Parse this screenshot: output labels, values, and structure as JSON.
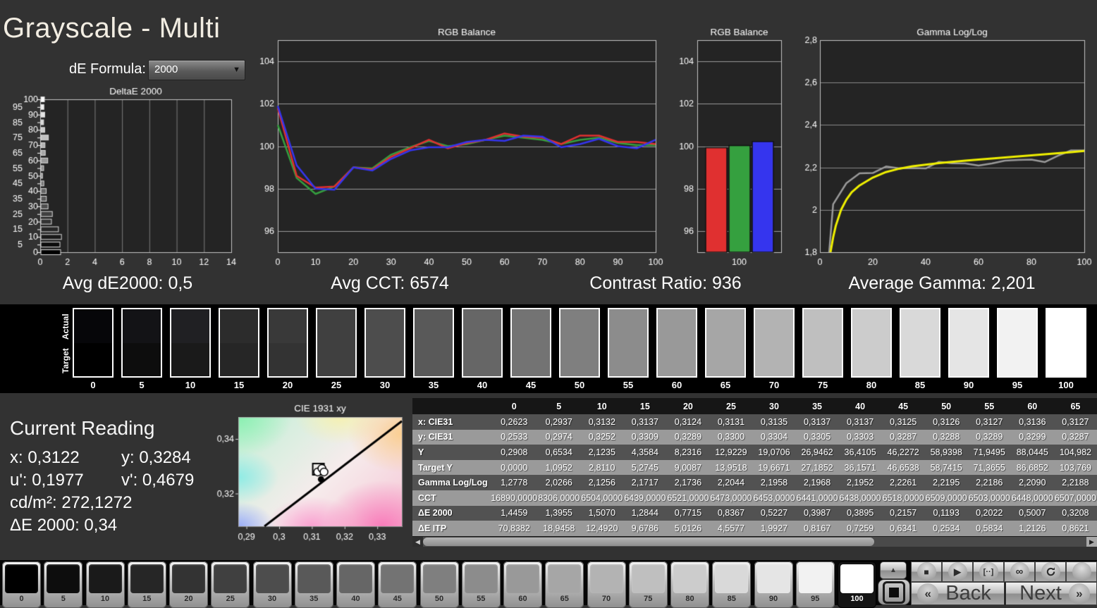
{
  "window": {
    "title": "Grayscale - Multi"
  },
  "controls": {
    "de_formula_label": "dE Formula:",
    "de_formula_value": "2000",
    "dropdown_arrow": "▼"
  },
  "stats": {
    "avg_de2000": "Avg dE2000: 0,5",
    "avg_cct": "Avg CCT: 6574",
    "contrast_ratio": "Contrast Ratio: 936",
    "average_gamma": "Average Gamma: 2,201"
  },
  "current_reading": {
    "heading": "Current Reading",
    "x": "x: 0,3122",
    "y": "y: 0,3284",
    "u": "u': 0,1977",
    "v": "v': 0,4679",
    "cd": "cd/m²: 272,1272",
    "de": "ΔE 2000: 0,34"
  },
  "swatch_strip": {
    "actual_label": "Actual",
    "target_label": "Target",
    "levels": [
      0,
      5,
      10,
      15,
      20,
      25,
      30,
      35,
      40,
      45,
      50,
      55,
      60,
      65,
      70,
      75,
      80,
      85,
      90,
      95,
      100
    ]
  },
  "table": {
    "columns": [
      "0",
      "5",
      "10",
      "15",
      "20",
      "25",
      "30",
      "35",
      "40",
      "45",
      "50",
      "55",
      "60",
      "65"
    ],
    "rows": [
      {
        "label": "x: CIE31",
        "values": [
          "0,2623",
          "0,2937",
          "0,3132",
          "0,3137",
          "0,3124",
          "0,3131",
          "0,3135",
          "0,3137",
          "0,3137",
          "0,3125",
          "0,3126",
          "0,3127",
          "0,3136",
          "0,3127"
        ]
      },
      {
        "label": "y: CIE31",
        "values": [
          "0,2533",
          "0,2974",
          "0,3252",
          "0,3309",
          "0,3289",
          "0,3300",
          "0,3304",
          "0,3305",
          "0,3303",
          "0,3287",
          "0,3288",
          "0,3289",
          "0,3299",
          "0,3287"
        ]
      },
      {
        "label": "Y",
        "values": [
          "0,2908",
          "0,6534",
          "2,1235",
          "4,3584",
          "8,2316",
          "12,9229",
          "19,0706",
          "26,9462",
          "36,4105",
          "46,2272",
          "58,9398",
          "71,9495",
          "88,0445",
          "104,982"
        ]
      },
      {
        "label": "Target Y",
        "values": [
          "0,0000",
          "1,0952",
          "2,8110",
          "5,2745",
          "9,0087",
          "13,9518",
          "19,6671",
          "27,1852",
          "36,1571",
          "46,6538",
          "58,7415",
          "71,3655",
          "86,6852",
          "103,769"
        ]
      },
      {
        "label": "Gamma Log/Log",
        "values": [
          "1,2778",
          "2,0266",
          "2,1256",
          "2,1717",
          "2,1736",
          "2,2044",
          "2,1958",
          "2,1968",
          "2,1952",
          "2,2261",
          "2,2195",
          "2,2186",
          "2,2090",
          "2,2188"
        ]
      },
      {
        "label": "CCT",
        "values": [
          "16890,0000",
          "8306,0000",
          "6504,0000",
          "6439,0000",
          "6521,0000",
          "6473,0000",
          "6453,0000",
          "6441,0000",
          "6438,0000",
          "6518,0000",
          "6509,0000",
          "6503,0000",
          "6448,0000",
          "6507,0000"
        ]
      },
      {
        "label": "ΔE 2000",
        "values": [
          "1,4459",
          "1,3955",
          "1,5070",
          "1,2844",
          "0,7715",
          "0,8367",
          "0,5227",
          "0,3987",
          "0,3895",
          "0,2157",
          "0,1193",
          "0,2022",
          "0,5007",
          "0,3208"
        ]
      },
      {
        "label": "ΔE ITP",
        "values": [
          "70,8382",
          "18,9458",
          "12,4920",
          "9,6786",
          "5,0126",
          "4,5577",
          "1,9927",
          "0,8167",
          "0,7259",
          "0,6341",
          "0,2534",
          "0,5834",
          "1,2126",
          "0,8621"
        ]
      }
    ],
    "scrollbar": {
      "left_arrow": "◀",
      "right_arrow": "▶"
    }
  },
  "bottom_bar": {
    "levels": [
      0,
      5,
      10,
      15,
      20,
      25,
      30,
      35,
      40,
      45,
      50,
      55,
      60,
      65,
      70,
      75,
      80,
      85,
      90,
      95,
      100
    ],
    "selected_level": 100,
    "up_arrow": "▲",
    "transport": {
      "stop": "■",
      "play": "▶",
      "range": "[··]",
      "loop": "∞"
    },
    "back_label": "Back",
    "next_label": "Next",
    "back_chevron": "«",
    "next_chevron": "»"
  },
  "colors": {
    "red_series": "#e03030",
    "green_series": "#35a03f",
    "blue_series": "#3535ee",
    "gamma_measured": "#9a9a9a",
    "gamma_reference": "#f0f000",
    "plot_bg": "#242424",
    "page_bg": "#323232"
  },
  "chart_data": [
    {
      "id": "deltae",
      "type": "bar",
      "orientation": "horizontal",
      "title": "DeltaE 2000",
      "categories": [
        0,
        5,
        10,
        15,
        20,
        25,
        30,
        35,
        40,
        45,
        50,
        55,
        60,
        65,
        70,
        75,
        80,
        85,
        90,
        95,
        100
      ],
      "values": [
        1.4459,
        1.3955,
        1.507,
        1.2844,
        0.7715,
        0.8367,
        0.5227,
        0.3987,
        0.3895,
        0.2157,
        0.1193,
        0.2022,
        0.5007,
        0.3208,
        0.3,
        0.55,
        0.28,
        0.2,
        0.28,
        0.22,
        0.26
      ],
      "xlim": [
        0,
        14
      ],
      "xticks": [
        0,
        2,
        4,
        6,
        8,
        10,
        12,
        14
      ],
      "grid": true
    },
    {
      "id": "rgb_line",
      "type": "line",
      "title": "RGB Balance",
      "x": [
        0,
        5,
        10,
        15,
        20,
        25,
        30,
        35,
        40,
        45,
        50,
        55,
        60,
        65,
        70,
        75,
        80,
        85,
        90,
        95,
        100
      ],
      "series": [
        {
          "name": "Green",
          "values": [
            101.0,
            98.5,
            97.75,
            98.1,
            99.0,
            98.95,
            99.6,
            99.95,
            100.25,
            100.0,
            100.1,
            100.3,
            100.5,
            100.4,
            100.3,
            100.1,
            100.3,
            100.4,
            100.15,
            100.05,
            100.05
          ]
        },
        {
          "name": "Red",
          "values": [
            101.8,
            98.6,
            98.05,
            98.1,
            99.0,
            98.9,
            99.5,
            99.9,
            100.3,
            99.9,
            100.15,
            100.3,
            100.6,
            100.45,
            100.4,
            100.1,
            100.5,
            100.5,
            100.2,
            100.2,
            100.1
          ]
        },
        {
          "name": "Blue",
          "values": [
            101.9,
            99.1,
            98.0,
            97.95,
            99.0,
            98.85,
            99.4,
            99.8,
            99.95,
            99.95,
            100.2,
            100.3,
            100.25,
            100.5,
            100.45,
            99.95,
            100.1,
            100.35,
            100.0,
            99.9,
            100.3
          ]
        }
      ],
      "ylim": [
        95,
        105
      ],
      "yticks": [
        96,
        98,
        100,
        102,
        104
      ],
      "xticks": [
        0,
        10,
        20,
        30,
        40,
        50,
        60,
        70,
        80,
        90,
        100
      ],
      "grid": true,
      "legend": "none"
    },
    {
      "id": "rgb_bar",
      "type": "bar",
      "title": "RGB Balance",
      "categories": [
        "100"
      ],
      "series": [
        {
          "name": "Red",
          "value": 99.93
        },
        {
          "name": "Green",
          "value": 100.03
        },
        {
          "name": "Blue",
          "value": 100.22
        }
      ],
      "ylim": [
        95,
        105
      ],
      "yticks": [
        96,
        98,
        100,
        102,
        104
      ]
    },
    {
      "id": "gamma",
      "type": "line",
      "title": "Gamma Log/Log",
      "x": [
        0,
        5,
        10,
        15,
        20,
        25,
        30,
        35,
        40,
        45,
        50,
        55,
        60,
        65,
        70,
        75,
        80,
        85,
        90,
        95,
        100
      ],
      "series": [
        {
          "name": "Measured",
          "values": [
            1.2778,
            2.0266,
            2.1256,
            2.1717,
            2.1736,
            2.2044,
            2.1958,
            2.1968,
            2.1952,
            2.2261,
            2.2195,
            2.2186,
            2.209,
            2.2188,
            2.232,
            2.235,
            2.237,
            2.225,
            2.255,
            2.28,
            2.28
          ]
        },
        {
          "name": "Reference",
          "ref_x": [
            4,
            5,
            6,
            8,
            10,
            12,
            15,
            20,
            25,
            30,
            35,
            40,
            45,
            50,
            55,
            60,
            65,
            70,
            75,
            80,
            85,
            90,
            95,
            100
          ],
          "values": [
            1.8,
            1.87,
            1.925,
            2.0,
            2.048,
            2.083,
            2.115,
            2.152,
            2.178,
            2.194,
            2.205,
            2.213,
            2.22,
            2.226,
            2.232,
            2.237,
            2.242,
            2.247,
            2.252,
            2.257,
            2.262,
            2.267,
            2.272,
            2.278
          ]
        }
      ],
      "ylim": [
        1.8,
        2.8
      ],
      "yticks": [
        1.8,
        2.0,
        2.2,
        2.4,
        2.6,
        2.8
      ],
      "yticks_display": [
        "1,8",
        "2",
        "2,2",
        "2,4",
        "2,6",
        "2,8"
      ],
      "xticks": [
        0,
        20,
        40,
        60,
        80,
        100
      ],
      "grid": true
    },
    {
      "id": "cie",
      "type": "scatter",
      "title": "CIE 1931 xy",
      "xlim": [
        0.2875,
        0.3375
      ],
      "ylim": [
        0.308,
        0.348
      ],
      "xticks": [
        0.29,
        0.3,
        0.31,
        0.32,
        0.33
      ],
      "xticks_display": [
        "0,29",
        "0,3",
        "0,31",
        "0,32",
        "0,33"
      ],
      "yticks": [
        0.32,
        0.34
      ],
      "yticks_display": [
        "0,32",
        "0,34"
      ],
      "locus_line": [
        [
          0.2955,
          0.308
        ],
        [
          0.3375,
          0.3465
        ]
      ],
      "marker_cluster": [
        0.3122,
        0.3284
      ],
      "marker_dot": [
        0.3128,
        0.3252
      ]
    }
  ]
}
